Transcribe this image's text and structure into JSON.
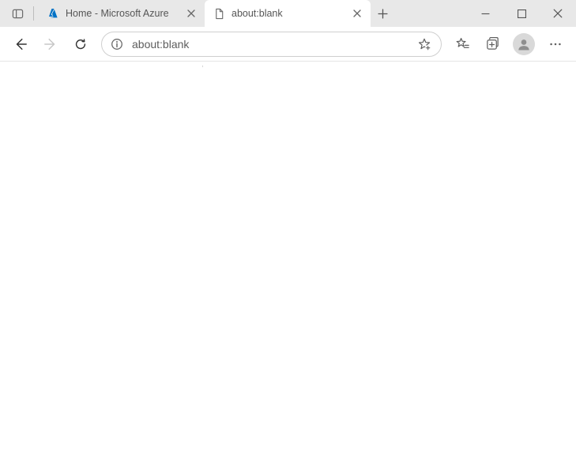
{
  "tabs": [
    {
      "title": "Home - Microsoft Azure",
      "favicon": "azure-icon",
      "active": false
    },
    {
      "title": "about:blank",
      "favicon": "page-icon",
      "active": true
    }
  ],
  "toolbar": {
    "url": "about:blank"
  },
  "colors": {
    "azure": "#0072C6",
    "tabbar_bg": "#e8e8e8"
  }
}
